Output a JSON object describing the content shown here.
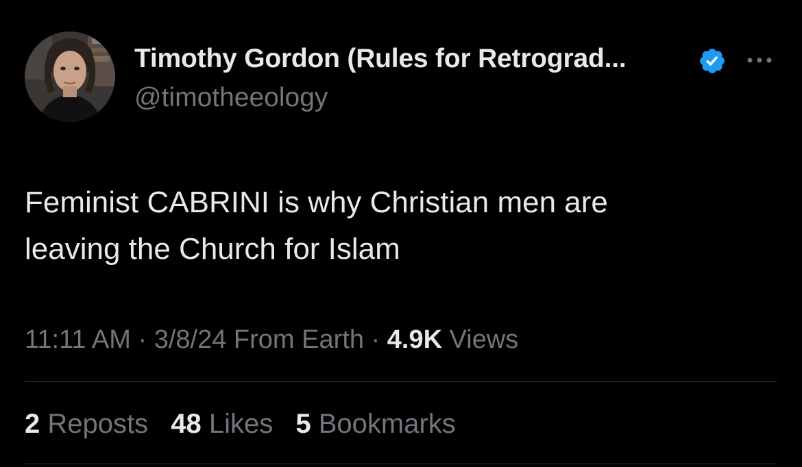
{
  "author": {
    "name": "Timothy Gordon (Rules for Retrograd...",
    "handle": "@timotheeology",
    "verified_icon": "verified-badge-icon",
    "verified_color": "#1d9bf0"
  },
  "more_icon": "more-horizontal-icon",
  "tweet": {
    "lines": [
      "Feminist CABRINI is why Christian men are",
      "leaving the Church for Islam"
    ]
  },
  "meta": {
    "time": "11:11 AM",
    "sep1": " · ",
    "date": "3/8/24",
    "source": " From Earth",
    "sep2": " · ",
    "views_count": "4.9K",
    "views_label": " Views"
  },
  "stats": {
    "reposts_count": "2",
    "reposts_label": " Reposts",
    "likes_count": "48",
    "likes_label": " Likes",
    "bookmarks_count": "5",
    "bookmarks_label": " Bookmarks"
  },
  "colors": {
    "background": "#000000",
    "primary_text": "#e7e9ea",
    "secondary_text": "#71767b",
    "divider": "#2f3336",
    "accent": "#1d9bf0"
  }
}
